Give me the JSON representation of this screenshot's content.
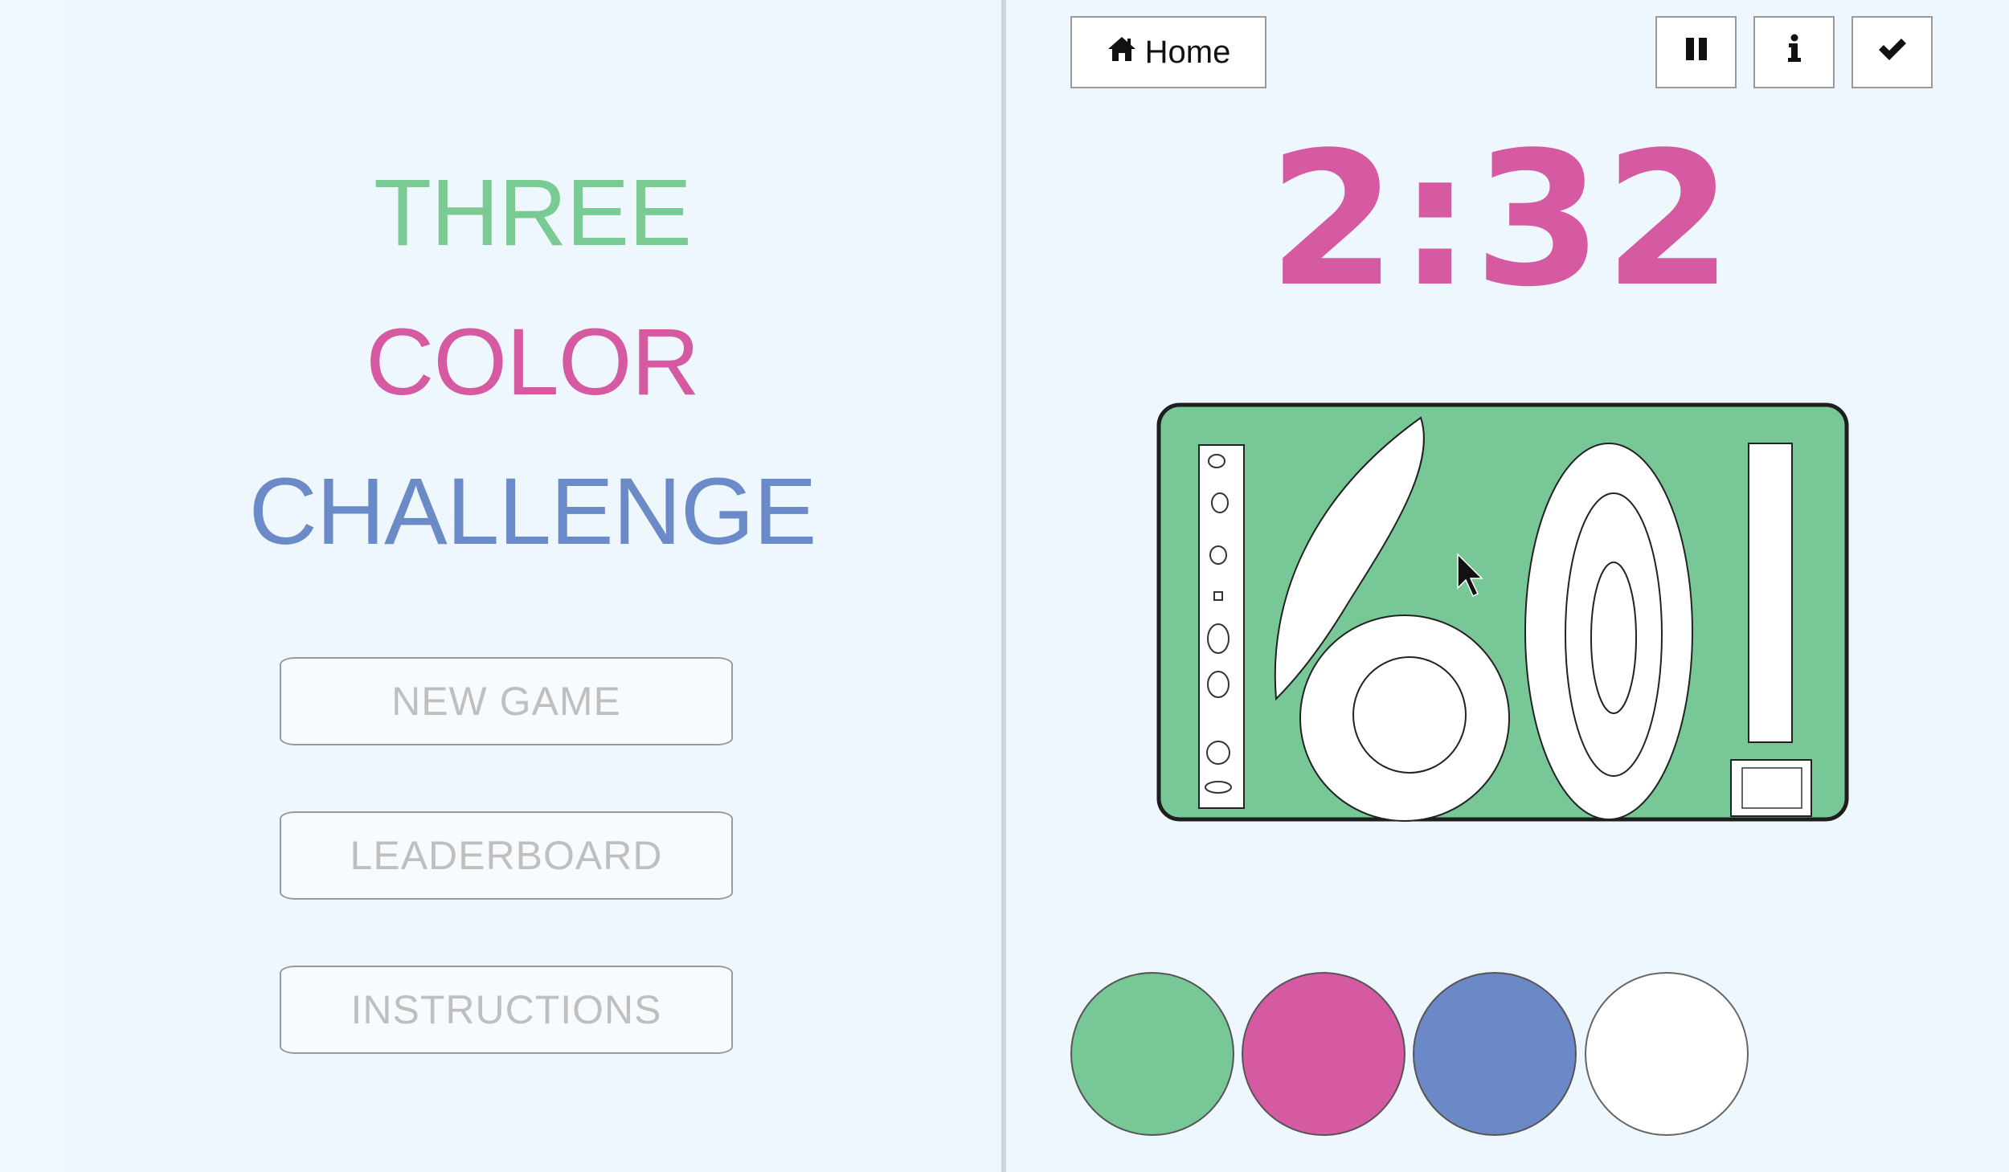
{
  "menu": {
    "title_words": [
      "THREE",
      "COLOR",
      "CHALLENGE"
    ],
    "buttons": {
      "new_game": "NEW GAME",
      "leaderboard": "LEADERBOARD",
      "instructions": "INSTRUCTIONS"
    }
  },
  "game": {
    "home_label": "Home",
    "timer": "2:32",
    "toolbar_icons": [
      "pause-icon",
      "info-icon",
      "check-icon"
    ],
    "palette": [
      {
        "name": "green",
        "color": "#77c896"
      },
      {
        "name": "pink",
        "color": "#d55aa1"
      },
      {
        "name": "blue",
        "color": "#6b89c6"
      },
      {
        "name": "white",
        "color": "#ffffff"
      }
    ]
  },
  "colors": {
    "background": "#eff7fe",
    "three": "#7aca94",
    "color": "#d55aa1",
    "challenge": "#6b8ac8",
    "board_fill": "#77c896"
  }
}
